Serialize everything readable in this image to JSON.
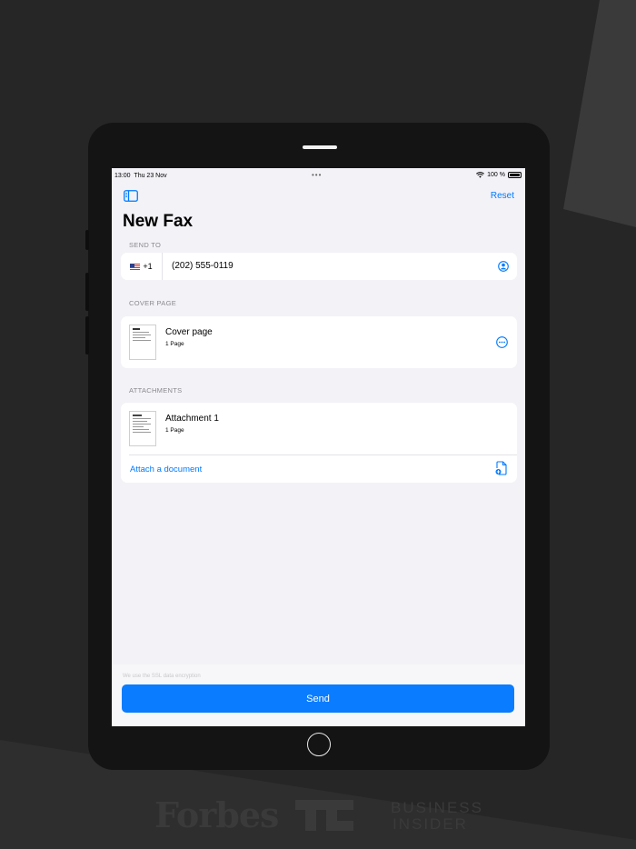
{
  "status_bar": {
    "time": "13:00",
    "date": "Thu 23 Nov",
    "dots": "•••",
    "battery": "100 %"
  },
  "nav": {
    "reset_label": "Reset",
    "title": "New Fax"
  },
  "send_to": {
    "section_label": "SEND TO",
    "country_code": "+1",
    "phone_number": "(202) 555-0119"
  },
  "cover_page": {
    "section_label": "COVER PAGE",
    "title": "Cover page",
    "pages": "1 Page"
  },
  "attachments": {
    "section_label": "ATTACHMENTS",
    "items": [
      {
        "title": "Attachment 1",
        "pages": "1 Page"
      }
    ],
    "attach_label": "Attach a document"
  },
  "footer": {
    "encryption_note": "We use the SSL data encryption",
    "send_label": "Send"
  },
  "press_logos": {
    "forbes": "Forbes",
    "business_insider_line1": "BUSINESS",
    "business_insider_line2": "INSIDER"
  },
  "colors": {
    "accent": "#007aff",
    "send_button": "#0a7cff",
    "background": "#262626"
  }
}
